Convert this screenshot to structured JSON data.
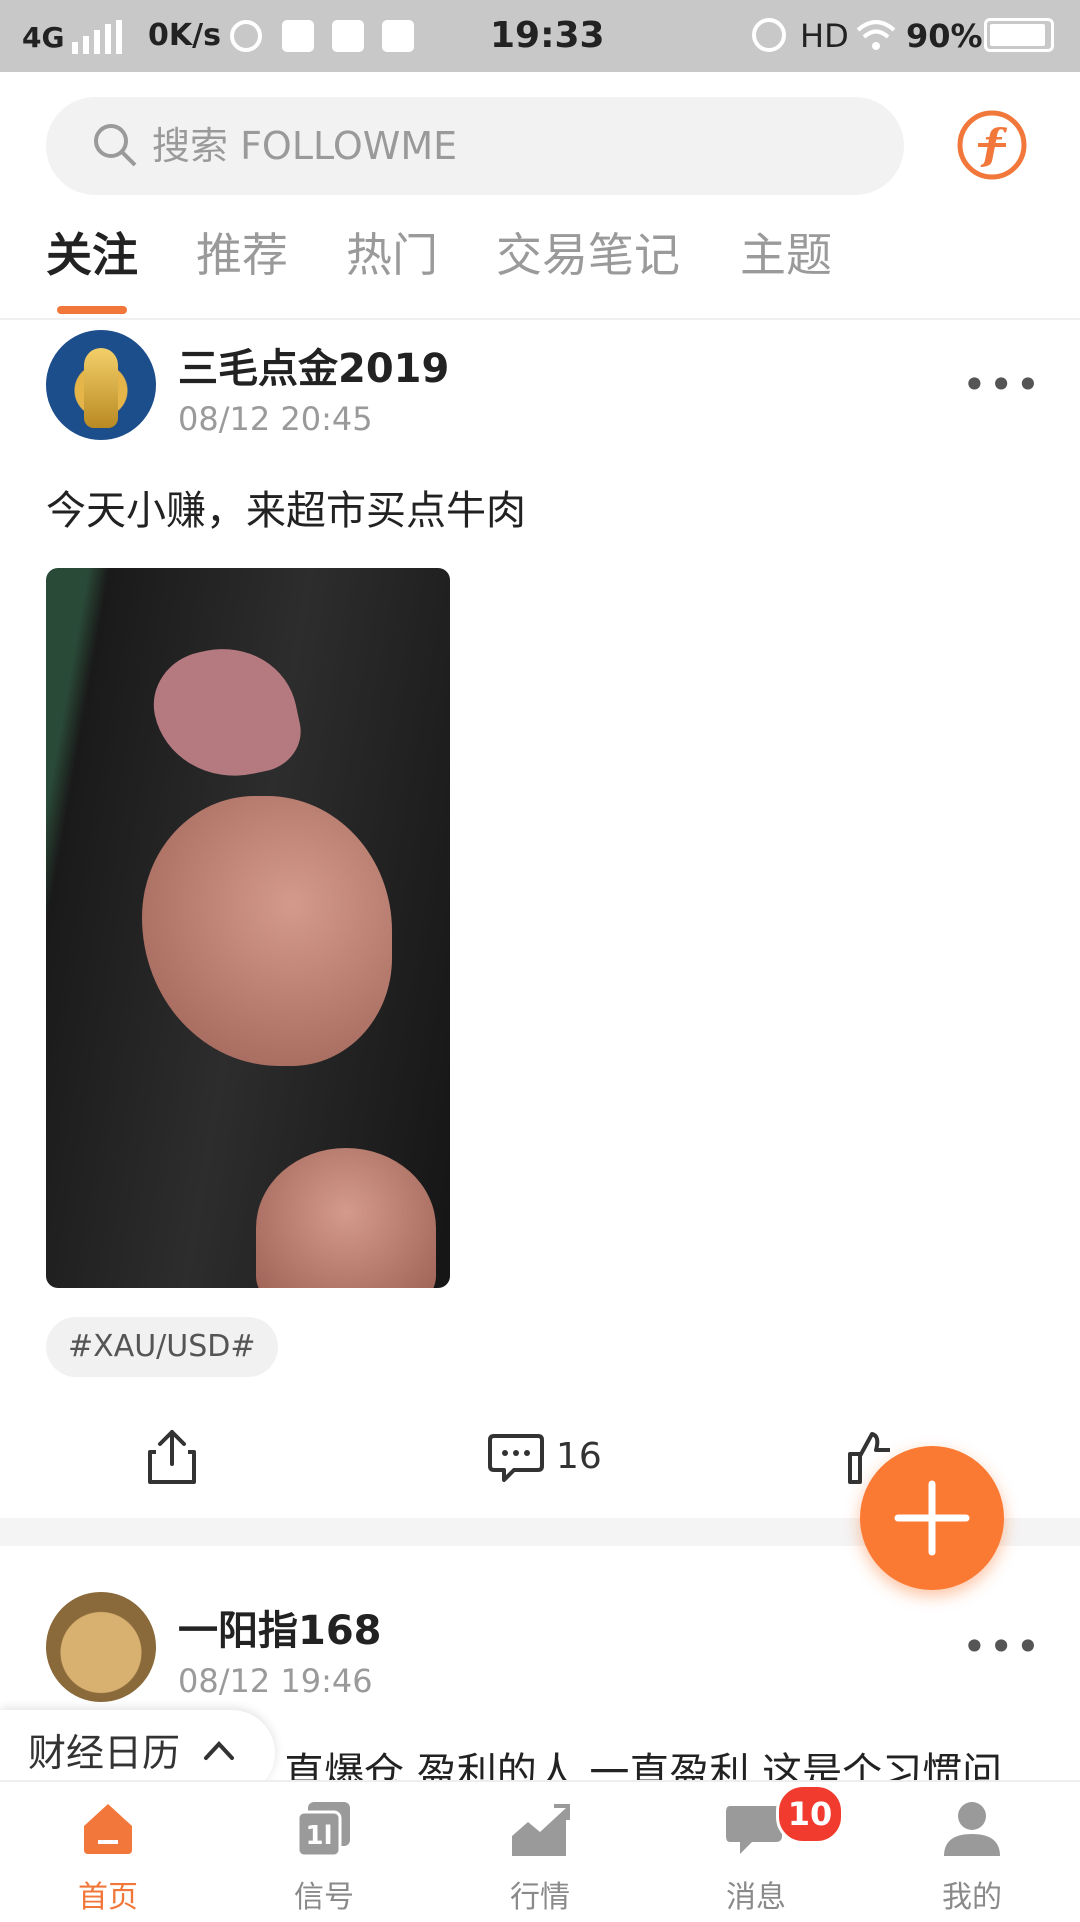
{
  "status_bar": {
    "network": "4G",
    "speed": "0K/s",
    "time": "19:33",
    "hd": "HD",
    "battery": "90%"
  },
  "search": {
    "placeholder": "搜索 FOLLOWME"
  },
  "tabs": [
    {
      "label": "关注",
      "active": true
    },
    {
      "label": "推荐"
    },
    {
      "label": "热门"
    },
    {
      "label": "交易笔记"
    },
    {
      "label": "主题"
    }
  ],
  "posts": [
    {
      "author": "三毛点金2019",
      "time": "08/12 20:45",
      "content": "今天小赚，来超市买点牛肉",
      "tag": "#XAU/USD#",
      "comments": "16"
    },
    {
      "author": "一阳指168",
      "time": "08/12 19:46",
      "content": "直爆仓 盈利的人 一直盈利 这是个习惯问"
    }
  ],
  "calendar_button": {
    "label": "财经日历"
  },
  "bottom_nav": [
    {
      "label": "首页",
      "active": true
    },
    {
      "label": "信号"
    },
    {
      "label": "行情"
    },
    {
      "label": "消息",
      "badge": "10"
    },
    {
      "label": "我的"
    }
  ],
  "colors": {
    "accent": "#f2773a",
    "fab": "#fb7a33",
    "badge": "#f23b2f"
  }
}
